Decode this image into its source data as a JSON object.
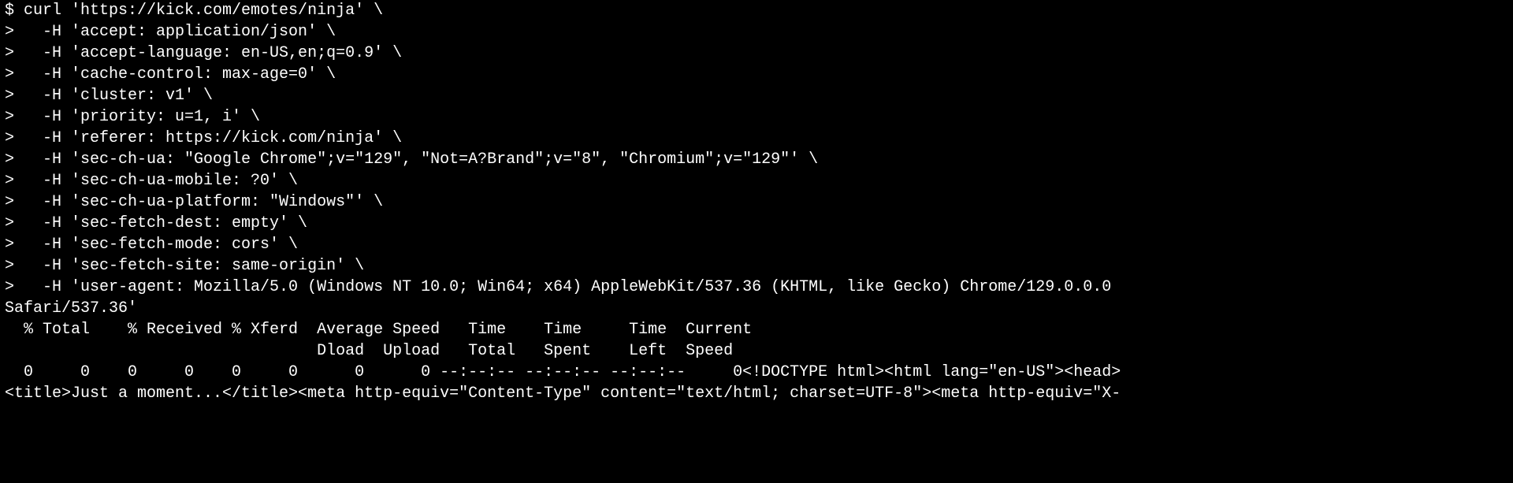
{
  "lines": [
    "$ curl 'https://kick.com/emotes/ninja' \\",
    ">   -H 'accept: application/json' \\",
    ">   -H 'accept-language: en-US,en;q=0.9' \\",
    ">   -H 'cache-control: max-age=0' \\",
    ">   -H 'cluster: v1' \\",
    ">   -H 'priority: u=1, i' \\",
    ">   -H 'referer: https://kick.com/ninja' \\",
    ">   -H 'sec-ch-ua: \"Google Chrome\";v=\"129\", \"Not=A?Brand\";v=\"8\", \"Chromium\";v=\"129\"' \\",
    ">   -H 'sec-ch-ua-mobile: ?0' \\",
    ">   -H 'sec-ch-ua-platform: \"Windows\"' \\",
    ">   -H 'sec-fetch-dest: empty' \\",
    ">   -H 'sec-fetch-mode: cors' \\",
    ">   -H 'sec-fetch-site: same-origin' \\",
    ">   -H 'user-agent: Mozilla/5.0 (Windows NT 10.0; Win64; x64) AppleWebKit/537.36 (KHTML, like Gecko) Chrome/129.0.0.0",
    "Safari/537.36'",
    "  % Total    % Received % Xferd  Average Speed   Time    Time     Time  Current",
    "                                 Dload  Upload   Total   Spent    Left  Speed",
    "  0     0    0     0    0     0      0      0 --:--:-- --:--:-- --:--:--     0<!DOCTYPE html><html lang=\"en-US\"><head>",
    "<title>Just a moment...</title><meta http-equiv=\"Content-Type\" content=\"text/html; charset=UTF-8\"><meta http-equiv=\"X-"
  ]
}
